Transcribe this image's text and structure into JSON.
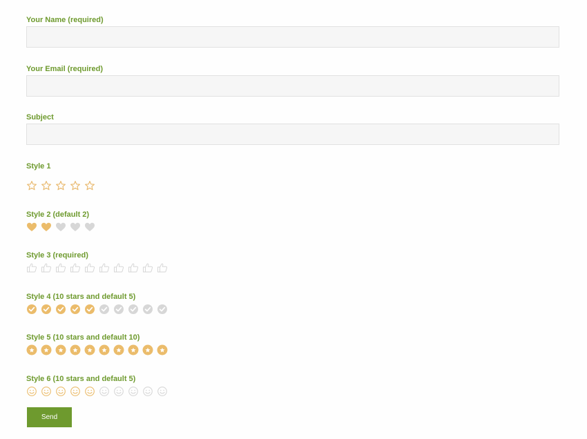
{
  "form": {
    "name_label": "Your Name (required)",
    "name_value": "",
    "email_label": "Your Email (required)",
    "email_value": "",
    "subject_label": "Subject",
    "subject_value": "",
    "send_label": "Send"
  },
  "ratings": [
    {
      "label": "Style 1",
      "icon": "star-outline-icon",
      "total": 5,
      "value": 0
    },
    {
      "label": "Style 2 (default 2)",
      "icon": "heart-icon",
      "total": 5,
      "value": 2
    },
    {
      "label": "Style 3 (required)",
      "icon": "thumbs-up-icon",
      "total": 10,
      "value": 0
    },
    {
      "label": "Style 4 (10 stars and default 5)",
      "icon": "check-circle-icon",
      "total": 10,
      "value": 5
    },
    {
      "label": "Style 5 (10 stars and default 10)",
      "icon": "star-circle-icon",
      "total": 10,
      "value": 10
    },
    {
      "label": "Style 6 (10 stars and default 5)",
      "icon": "smiley-icon",
      "total": 10,
      "value": 5
    }
  ],
  "colors": {
    "accent": "#6e9a2e",
    "active": "#ebbc6b",
    "inactive": "#d7d7d7"
  }
}
